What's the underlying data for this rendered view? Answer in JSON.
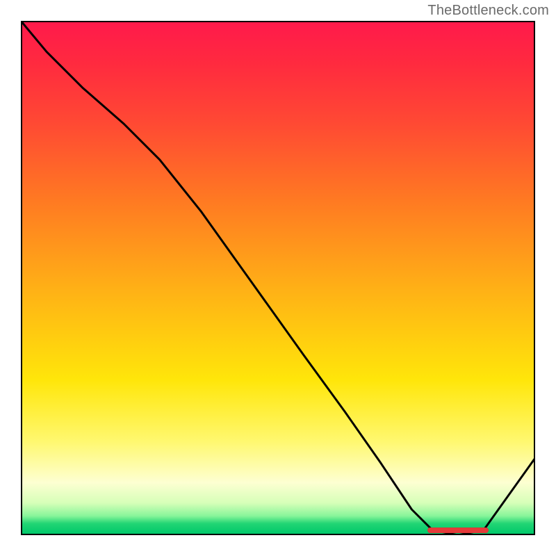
{
  "watermark": "TheBottleneck.com",
  "chart_data": {
    "type": "line",
    "title": "",
    "xlabel": "",
    "ylabel": "",
    "xlim": [
      0,
      100
    ],
    "ylim": [
      0,
      100
    ],
    "series": [
      {
        "name": "curve",
        "x": [
          0,
          5,
          12,
          20,
          27,
          35,
          45,
          55,
          63,
          70,
          76,
          80,
          85,
          90,
          100
        ],
        "values": [
          100,
          94,
          87,
          80,
          73,
          63,
          49,
          35,
          24,
          14,
          5,
          1,
          0,
          1,
          15
        ]
      }
    ],
    "marker": {
      "x_start": 79,
      "x_end": 91,
      "y": 0
    },
    "grid": false,
    "border": true
  }
}
